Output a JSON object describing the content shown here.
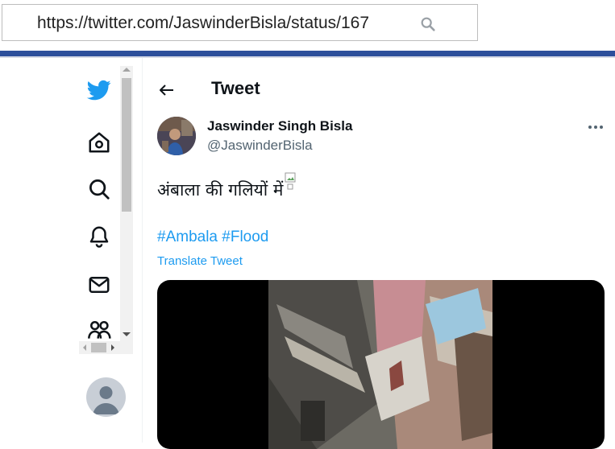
{
  "browser": {
    "url": "https://twitter.com/JaswinderBisla/status/167"
  },
  "nav": {
    "items": [
      {
        "name": "twitter-logo-icon"
      },
      {
        "name": "home-icon"
      },
      {
        "name": "explore-search-icon"
      },
      {
        "name": "notifications-bell-icon"
      },
      {
        "name": "messages-mail-icon"
      },
      {
        "name": "communities-icon"
      }
    ]
  },
  "header": {
    "title": "Tweet"
  },
  "tweet": {
    "author_name": "Jaswinder Singh Bisla",
    "author_handle": "@JaswinderBisla",
    "text": "अंबाला की गलियों में",
    "hashtags": [
      "#Ambala",
      "#Flood"
    ],
    "translate_label": "Translate Tweet"
  },
  "colors": {
    "accent": "#1d9bf0",
    "browser_bar": "#2d4f9b",
    "text_primary": "#0f1419",
    "text_secondary": "#536471"
  }
}
